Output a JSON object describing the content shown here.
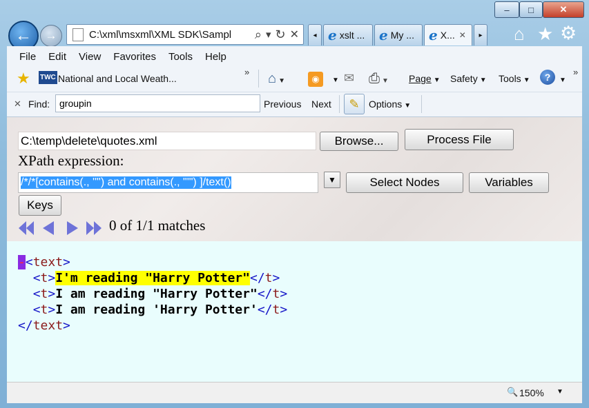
{
  "window": {
    "minimize_label": "–",
    "maximize_label": "□",
    "close_label": "✕"
  },
  "address": {
    "url": "C:\\xml\\msxml\\XML SDK\\Sampl",
    "search_glyph": "⌕",
    "dropdown_glyph": "▾",
    "refresh_glyph": "↻",
    "stop_glyph": "✕"
  },
  "tabs": [
    {
      "label": "xslt ..."
    },
    {
      "label": "My ..."
    },
    {
      "label": "X..."
    }
  ],
  "menu": {
    "file": "File",
    "edit": "Edit",
    "view": "View",
    "favorites": "Favorites",
    "tools": "Tools",
    "help": "Help"
  },
  "favorites_bar": {
    "twc_logo": "TWC",
    "item": "National and Local Weath..."
  },
  "command_bar": {
    "page": "Page",
    "safety": "Safety",
    "tools": "Tools",
    "more": "»"
  },
  "find_bar": {
    "close": "✕",
    "label": "Find:",
    "value": "groupin",
    "previous": "Previous",
    "next": "Next",
    "options": "Options"
  },
  "form": {
    "file_path": "C:\\temp\\delete\\quotes.xml",
    "browse_label": "Browse...",
    "process_label": "Process File",
    "xpath_label": "XPath expression:",
    "xpath_value": "/*/*[contains(., '\"') and contains(., \"'\") ]/text()",
    "select_nodes_label": "Select Nodes",
    "variables_label": "Variables",
    "keys_label": "Keys",
    "matches_text": "0 of 1/1 matches"
  },
  "xml_view": {
    "collapse_marker": "-",
    "root_tag": "text",
    "child_tag": "t",
    "lines": [
      "I'm reading \"Harry Potter\"",
      "I am reading \"Harry Potter\"",
      "I am reading 'Harry Potter'"
    ]
  },
  "status_bar": {
    "zoom": "150%"
  },
  "colors": {
    "accent": "#1a73c8",
    "highlight": "#ffff00",
    "selection": "#3399ff",
    "xml_bg": "#e9fdfd"
  }
}
